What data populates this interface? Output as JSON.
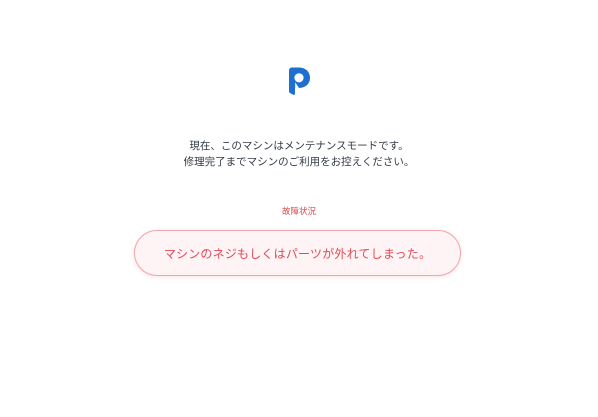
{
  "brand": {
    "logo_icon": "app-logo-icon",
    "accent_color": "#1f6fd1"
  },
  "message": {
    "line1": "現在、このマシンはメンテナンスモードです。",
    "line2": "修理完了までマシンのご利用をお控えください。"
  },
  "status": {
    "label": "故障状況",
    "description": "マシンのネジもしくはパーツが外れてしまった。",
    "color": "#e04a55"
  }
}
